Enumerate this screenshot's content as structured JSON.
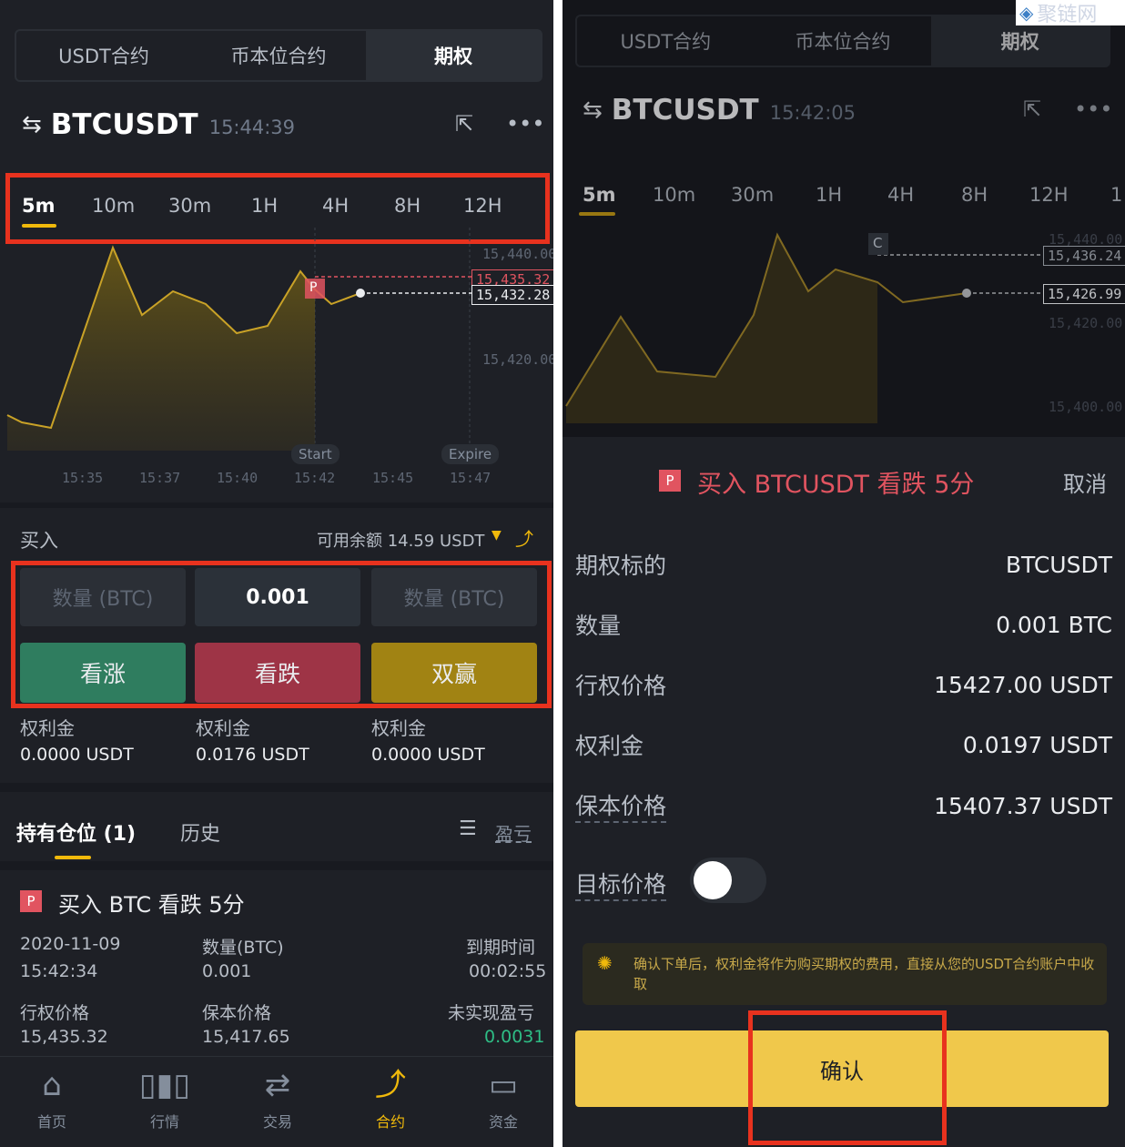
{
  "colors": {
    "accent": "#f0b90b",
    "up": "#2ebd85",
    "down": "#e15460",
    "dual": "#c99400",
    "highlight": "#e8321e"
  },
  "top_tabs": [
    "USDT合约",
    "币本位合约",
    "期权"
  ],
  "left": {
    "symbol": "BTCUSDT",
    "time": "15:44:39",
    "intervals": [
      "5m",
      "10m",
      "30m",
      "1H",
      "4H",
      "8H",
      "12H"
    ],
    "chart": {
      "y_ticks": [
        "15,440.00",
        "15,420.00"
      ],
      "x_ticks": [
        "15:35",
        "15:37",
        "15:40",
        "15:42",
        "15:45",
        "15:47"
      ],
      "strike_tag": "15,435.32",
      "price_tag": "15,432.28",
      "marker": "P",
      "start_label": "Start",
      "expire_label": "Expire"
    },
    "buy_label": "买入",
    "balance": "可用余额 14.59 USDT",
    "qty_placeholder_left": "数量 (BTC)",
    "qty_value": "0.001",
    "qty_placeholder_right": "数量 (BTC)",
    "btn_up": "看涨",
    "btn_down": "看跌",
    "btn_dual": "双赢",
    "premiums": [
      {
        "label": "权利金",
        "value": "0.0000 USDT"
      },
      {
        "label": "权利金",
        "value": "0.0176 USDT"
      },
      {
        "label": "权利金",
        "value": "0.0000 USDT"
      }
    ],
    "tab_positions": "持有仓位 (1)",
    "tab_history": "历史",
    "pnl_label": "盈亏",
    "position": {
      "badge": "P",
      "title": "买入 BTC 看跌 5分",
      "date": "2020-11-09",
      "time": "15:42:34",
      "qty_label": "数量(BTC)",
      "qty_value": "0.001",
      "expiry_label": "到期时间",
      "expiry_value": "00:02:55",
      "strike_label": "行权价格",
      "strike_value": "15,435.32",
      "breakeven_label": "保本价格",
      "breakeven_value": "15,417.65",
      "upnl_label": "未实现盈亏",
      "upnl_value": "0.0031"
    },
    "nav": [
      "首页",
      "行情",
      "交易",
      "合约",
      "资金"
    ]
  },
  "right": {
    "symbol": "BTCUSDT",
    "time": "15:42:05",
    "intervals": [
      "5m",
      "10m",
      "30m",
      "1H",
      "4H",
      "8H",
      "12H",
      "1"
    ],
    "chart": {
      "y_ticks": [
        "15,440.00",
        "15,420.00",
        "15,400.00"
      ],
      "tag_top": "15,436.24",
      "tag_price": "15,426.99",
      "marker": "C"
    },
    "sheet_badge": "P",
    "sheet_title": "买入 BTCUSDT 看跌 5分",
    "cancel": "取消",
    "rows": [
      {
        "k": "期权标的",
        "v": "BTCUSDT"
      },
      {
        "k": "数量",
        "v": "0.001 BTC"
      },
      {
        "k": "行权价格",
        "v": "15427.00 USDT"
      },
      {
        "k": "权利金",
        "v": "0.0197 USDT"
      },
      {
        "k": "保本价格",
        "v": "15407.37 USDT"
      }
    ],
    "target_label": "目标价格",
    "notice": "确认下单后，权利金将作为购买期权的费用，直接从您的USDT合约账户中收取",
    "confirm": "确认",
    "watermark": "聚链网"
  }
}
